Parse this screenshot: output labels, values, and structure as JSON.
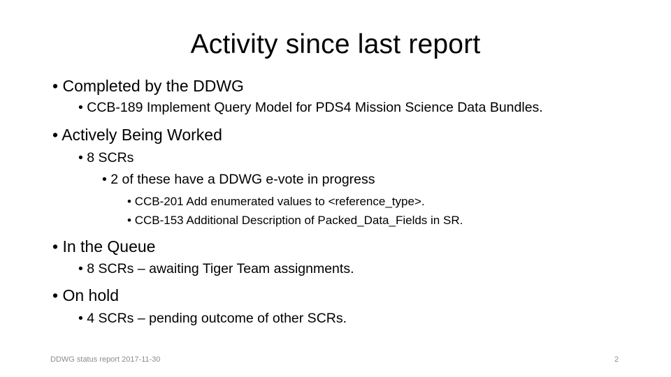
{
  "slide": {
    "title": "Activity since last report",
    "bullet_char": "•",
    "sections": [
      {
        "label": "Completed by the DDWG",
        "items": [
          {
            "label": "CCB-189 Implement Query Model for PDS4 Mission Science Data Bundles."
          }
        ]
      },
      {
        "label": "Actively Being Worked",
        "items": [
          {
            "label": "8 SCRs",
            "sub": {
              "label": "2 of these have a DDWG e-vote in progress",
              "items": [
                "CCB-201 Add enumerated values to <reference_type>.",
                "CCB-153 Additional Description of Packed_Data_Fields in SR."
              ]
            }
          }
        ]
      },
      {
        "label": "In the Queue",
        "items": [
          {
            "label": "8 SCRs – awaiting Tiger Team assignments."
          }
        ]
      },
      {
        "label": "On hold",
        "items": [
          {
            "label": "4 SCRs – pending outcome of other SCRs."
          }
        ]
      }
    ],
    "footer": {
      "text": "DDWG status report 2017-11-30",
      "page_number": "2"
    }
  }
}
